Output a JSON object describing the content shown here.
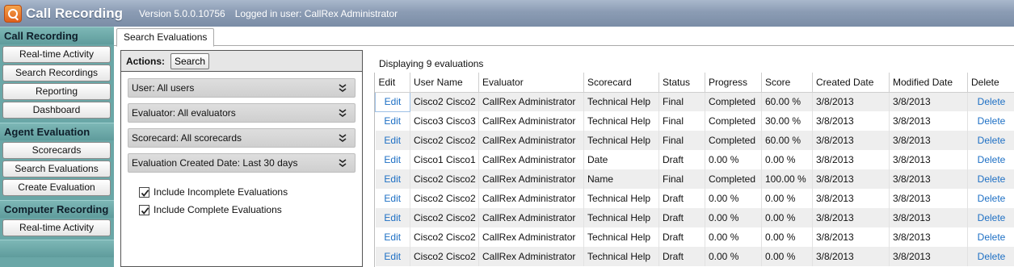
{
  "app": {
    "title": "Call Recording",
    "version": "Version 5.0.0.10756",
    "logged_in": "Logged in user: CallRex Administrator"
  },
  "sidebar": {
    "sections": [
      {
        "title": "Call Recording",
        "items": [
          "Real-time Activity",
          "Search Recordings",
          "Reporting",
          "Dashboard"
        ]
      },
      {
        "title": "Agent Evaluation",
        "items": [
          "Scorecards",
          "Search Evaluations",
          "Create Evaluation"
        ]
      },
      {
        "title": "Computer Recording",
        "items": [
          "Real-time Activity"
        ]
      }
    ]
  },
  "tabs": {
    "active": "Search Evaluations"
  },
  "filters": {
    "actions_label": "Actions:",
    "search_label": "Search",
    "dropdowns": [
      {
        "label": "User:  All users"
      },
      {
        "label": "Evaluator:  All evaluators"
      },
      {
        "label": "Scorecard:  All scorecards"
      },
      {
        "label": "Evaluation Created Date:  Last 30 days"
      }
    ],
    "checkboxes": [
      {
        "label": "Include Incomplete Evaluations",
        "checked": true
      },
      {
        "label": "Include Complete Evaluations",
        "checked": true
      }
    ]
  },
  "results": {
    "summary": "Displaying 9 evaluations",
    "columns": [
      "Edit",
      "User Name",
      "Evaluator",
      "Scorecard",
      "Status",
      "Progress",
      "Score",
      "Created Date",
      "Modified Date",
      "Delete"
    ],
    "rows": [
      [
        "Edit",
        "Cisco2 Cisco2",
        "CallRex Administrator",
        "Technical Help",
        "Final",
        "Completed",
        "60.00 %",
        "3/8/2013",
        "3/8/2013",
        "Delete"
      ],
      [
        "Edit",
        "Cisco3 Cisco3",
        "CallRex Administrator",
        "Technical Help",
        "Final",
        "Completed",
        "30.00 %",
        "3/8/2013",
        "3/8/2013",
        "Delete"
      ],
      [
        "Edit",
        "Cisco2 Cisco2",
        "CallRex Administrator",
        "Technical Help",
        "Final",
        "Completed",
        "60.00 %",
        "3/8/2013",
        "3/8/2013",
        "Delete"
      ],
      [
        "Edit",
        "Cisco1 Cisco1",
        "CallRex Administrator",
        "Date",
        "Draft",
        "0.00 %",
        "0.00 %",
        "3/8/2013",
        "3/8/2013",
        "Delete"
      ],
      [
        "Edit",
        "Cisco2 Cisco2",
        "CallRex Administrator",
        "Name",
        "Final",
        "Completed",
        "100.00 %",
        "3/8/2013",
        "3/8/2013",
        "Delete"
      ],
      [
        "Edit",
        "Cisco2 Cisco2",
        "CallRex Administrator",
        "Technical Help",
        "Draft",
        "0.00 %",
        "0.00 %",
        "3/8/2013",
        "3/8/2013",
        "Delete"
      ],
      [
        "Edit",
        "Cisco2 Cisco2",
        "CallRex Administrator",
        "Technical Help",
        "Draft",
        "0.00 %",
        "0.00 %",
        "3/8/2013",
        "3/8/2013",
        "Delete"
      ],
      [
        "Edit",
        "Cisco2 Cisco2",
        "CallRex Administrator",
        "Technical Help",
        "Draft",
        "0.00 %",
        "0.00 %",
        "3/8/2013",
        "3/8/2013",
        "Delete"
      ],
      [
        "Edit",
        "Cisco2 Cisco2",
        "CallRex Administrator",
        "Technical Help",
        "Draft",
        "0.00 %",
        "0.00 %",
        "3/8/2013",
        "3/8/2013",
        "Delete"
      ]
    ]
  },
  "colors": {
    "titlebar": "#8b9cb4",
    "sidebar": "#6aa7a7",
    "link": "#1d6fc4",
    "row_alt": "#eeeeee"
  }
}
